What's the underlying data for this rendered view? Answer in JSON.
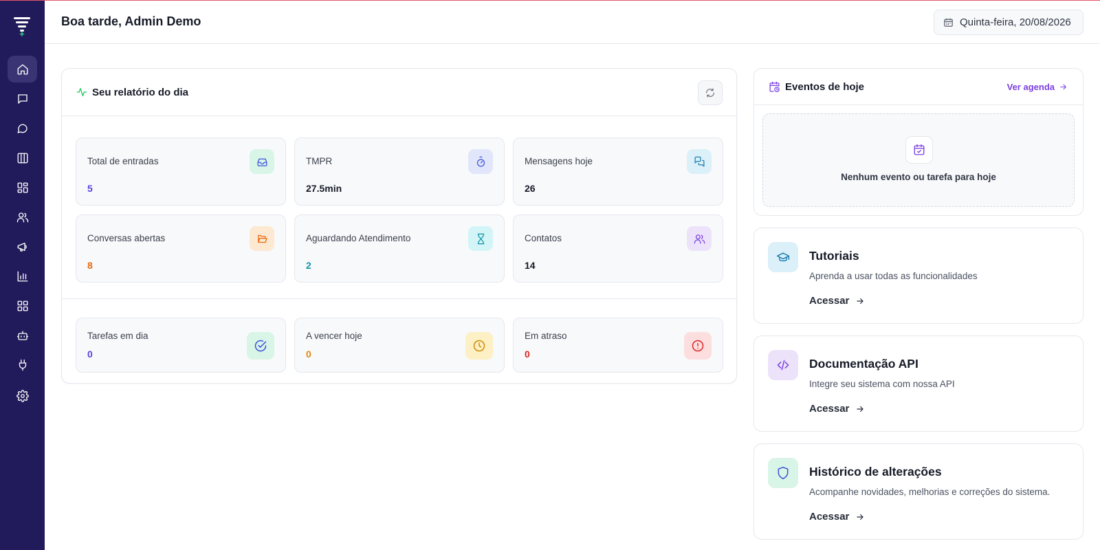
{
  "header": {
    "greeting": "Boa tarde, Admin Demo",
    "date": "Quinta-feira, 20/08/2026"
  },
  "sidebar": {
    "items": [
      {
        "icon": "home-icon"
      },
      {
        "icon": "message-square-icon"
      },
      {
        "icon": "message-circle-icon"
      },
      {
        "icon": "columns-icon"
      },
      {
        "icon": "dashboard-icon"
      },
      {
        "icon": "users-icon"
      },
      {
        "icon": "megaphone-icon"
      },
      {
        "icon": "bar-chart-icon"
      },
      {
        "icon": "grid-icon"
      },
      {
        "icon": "bot-icon"
      },
      {
        "icon": "plug-icon"
      },
      {
        "icon": "settings-icon"
      }
    ]
  },
  "report": {
    "title": "Seu relatório do dia",
    "stats": [
      {
        "label": "Total de entradas",
        "value": "5",
        "color": "#5b3fe0",
        "icon": "inbox-icon"
      },
      {
        "label": "TMPR",
        "value": "27.5min",
        "color": "#151a26",
        "icon": "timer-icon"
      },
      {
        "label": "Mensagens hoje",
        "value": "26",
        "color": "#151a26",
        "icon": "messages-icon"
      },
      {
        "label": "Conversas abertas",
        "value": "8",
        "color": "#e8680c",
        "icon": "folder-open-icon"
      },
      {
        "label": "Aguardando Atendimento",
        "value": "2",
        "color": "#0f95a8",
        "icon": "hourglass-icon"
      },
      {
        "label": "Contatos",
        "value": "14",
        "color": "#151a26",
        "icon": "contacts-icon"
      }
    ],
    "tasks": [
      {
        "label": "Tarefas em dia",
        "value": "0",
        "color": "#5b3fe0",
        "icon": "check-circle-icon"
      },
      {
        "label": "A vencer hoje",
        "value": "0",
        "color": "#e08a0c",
        "icon": "clock-icon"
      },
      {
        "label": "Em atraso",
        "value": "0",
        "color": "#d92626",
        "icon": "alert-circle-icon"
      }
    ]
  },
  "events": {
    "title": "Eventos de hoje",
    "link": "Ver agenda",
    "empty": "Nenhum evento ou tarefa para hoje"
  },
  "links": [
    {
      "title": "Tutoriais",
      "desc": "Aprenda a usar todas as funcionalidades",
      "action": "Acessar",
      "icon": "graduation-cap-icon"
    },
    {
      "title": "Documentação API",
      "desc": "Integre seu sistema com nossa API",
      "action": "Acessar",
      "icon": "code-icon"
    },
    {
      "title": "Histórico de alterações",
      "desc": "Acompanhe novidades, melhorias e correções do sistema.",
      "action": "Acessar",
      "icon": "shield-icon"
    }
  ]
}
